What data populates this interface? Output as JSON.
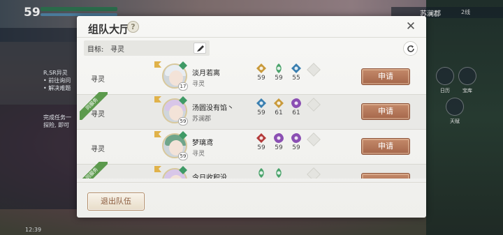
{
  "hud": {
    "level": "59",
    "location": "苏澜郡",
    "line": "2线",
    "time": "12:39",
    "tasks": [
      "R,SR异灵",
      "• 前往询问",
      "• 解决难题",
      "完成任务一",
      "探险, 即可"
    ],
    "right_buttons": [
      "日历",
      "宝库",
      "天赋"
    ]
  },
  "dialog": {
    "title": "组队大厅",
    "help": "?",
    "close": "✕",
    "target_label": "目标:",
    "target_value": "寻灵",
    "leave_label": "退出队伍",
    "rows": [
      {
        "target": "寻灵",
        "ribbon": "",
        "name": "淡月若离",
        "server": "寻灵",
        "level": "17",
        "avatar_hair": "#e8edf2",
        "members": [
          {
            "icon": "fire-crest-icon",
            "color": "#c99a3a",
            "level": "59"
          },
          {
            "icon": "leaf-crest-icon",
            "color": "#4aa36b",
            "level": "59"
          },
          {
            "icon": "water-crest-icon",
            "color": "#3a7fb0",
            "level": "55"
          }
        ],
        "apply_label": "申请"
      },
      {
        "target": "寻灵",
        "ribbon": "同服务",
        "name": "汤圆没有馅丶",
        "server": "苏澜郡",
        "level": "59",
        "avatar_hair": "#d8c6e8",
        "members": [
          {
            "icon": "water-crest-icon",
            "color": "#3a7fb0",
            "level": "59"
          },
          {
            "icon": "fire-crest-icon",
            "color": "#c99a3a",
            "level": "61"
          },
          {
            "icon": "spiral-crest-icon",
            "color": "#8b4fb3",
            "level": "61"
          }
        ],
        "apply_label": "申请"
      },
      {
        "target": "寻灵",
        "ribbon": "",
        "name": "梦璃鸢",
        "server": "寻灵",
        "level": "59",
        "avatar_hair": "#6fa58a",
        "members": [
          {
            "icon": "blood-crest-icon",
            "color": "#b33a3a",
            "level": "59"
          },
          {
            "icon": "spiral-crest-icon",
            "color": "#8b4fb3",
            "level": "59"
          },
          {
            "icon": "spiral-crest-icon",
            "color": "#8b4fb3",
            "level": "59"
          }
        ],
        "apply_label": "申请"
      },
      {
        "target": "",
        "ribbon": "同服务",
        "name": "今日收积没",
        "server": "",
        "level": "",
        "avatar_hair": "#d8c6e8",
        "members": [
          {
            "icon": "leaf-crest-icon",
            "color": "#4aa36b",
            "level": ""
          },
          {
            "icon": "leaf-crest-icon",
            "color": "#4aa36b",
            "level": ""
          }
        ],
        "apply_label": ""
      }
    ]
  },
  "colors": {
    "apply_button": "#a5664a",
    "ribbon": "#5c9a4d",
    "leave_text": "#8a5a3c"
  }
}
